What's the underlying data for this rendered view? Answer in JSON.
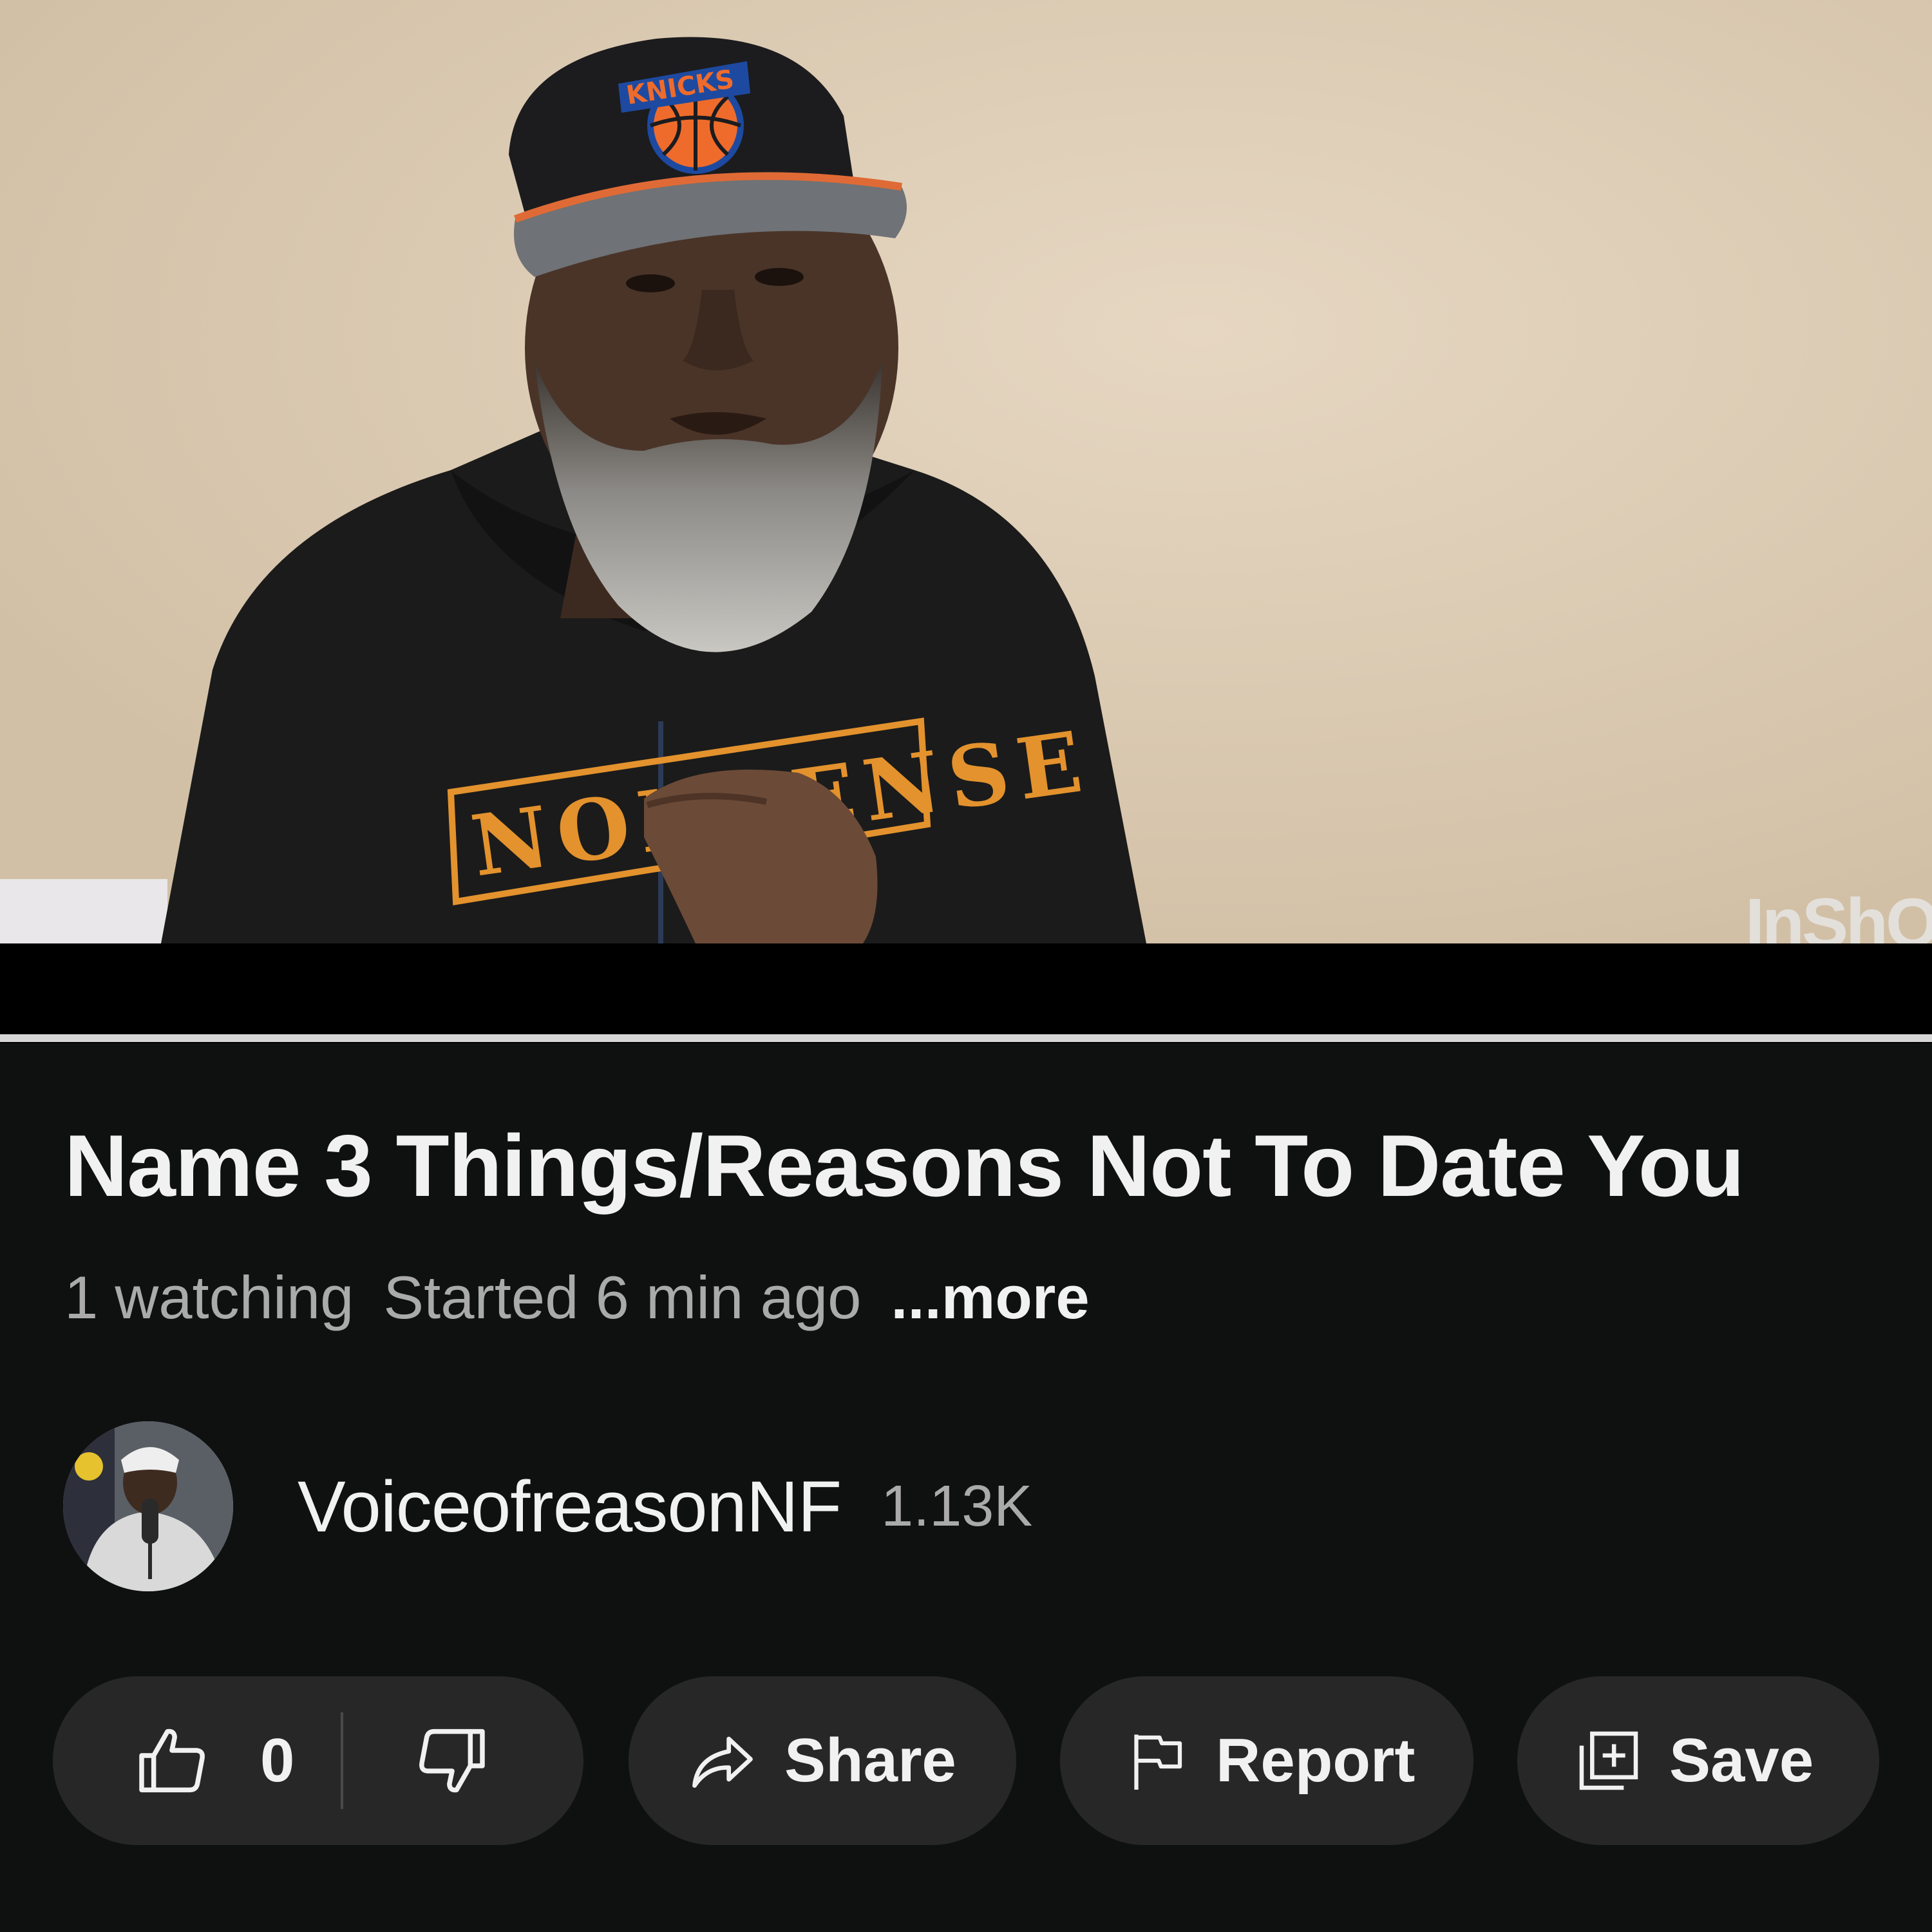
{
  "player": {
    "watermark": "InShOt",
    "shirt_text": "NONSENSE",
    "cap_text": "KNICKS"
  },
  "video": {
    "title": "Name 3 Things/Reasons Not To Date You",
    "watching": "1 watching",
    "started": "Started 6 min ago",
    "more_label": "...more"
  },
  "channel": {
    "name": "VoiceofreasonNF",
    "subscribers": "1.13K"
  },
  "actions": {
    "like_count": "0",
    "like_icon": "thumbs-up-icon",
    "dislike_icon": "thumbs-down-icon",
    "share_label": "Share",
    "share_icon": "share-arrow-icon",
    "report_label": "Report",
    "report_icon": "flag-icon",
    "save_label": "Save",
    "save_icon": "add-to-playlist-icon"
  },
  "colors": {
    "background": "#0f1111",
    "pill": "#272727",
    "text_primary": "#f1f1f1",
    "text_secondary": "#aaaaaa",
    "progress_track": "#d6d6d6"
  }
}
